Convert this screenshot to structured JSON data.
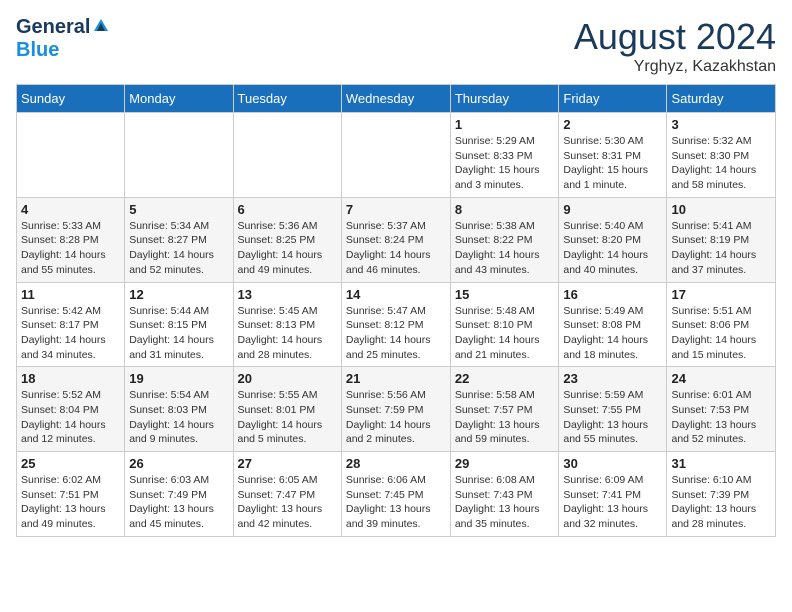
{
  "logo": {
    "general": "General",
    "blue": "Blue"
  },
  "title": "August 2024",
  "location": "Yrghyz, Kazakhstan",
  "days_of_week": [
    "Sunday",
    "Monday",
    "Tuesday",
    "Wednesday",
    "Thursday",
    "Friday",
    "Saturday"
  ],
  "weeks": [
    [
      {
        "day": "",
        "info": ""
      },
      {
        "day": "",
        "info": ""
      },
      {
        "day": "",
        "info": ""
      },
      {
        "day": "",
        "info": ""
      },
      {
        "day": "1",
        "info": "Sunrise: 5:29 AM\nSunset: 8:33 PM\nDaylight: 15 hours and 3 minutes."
      },
      {
        "day": "2",
        "info": "Sunrise: 5:30 AM\nSunset: 8:31 PM\nDaylight: 15 hours and 1 minute."
      },
      {
        "day": "3",
        "info": "Sunrise: 5:32 AM\nSunset: 8:30 PM\nDaylight: 14 hours and 58 minutes."
      }
    ],
    [
      {
        "day": "4",
        "info": "Sunrise: 5:33 AM\nSunset: 8:28 PM\nDaylight: 14 hours and 55 minutes."
      },
      {
        "day": "5",
        "info": "Sunrise: 5:34 AM\nSunset: 8:27 PM\nDaylight: 14 hours and 52 minutes."
      },
      {
        "day": "6",
        "info": "Sunrise: 5:36 AM\nSunset: 8:25 PM\nDaylight: 14 hours and 49 minutes."
      },
      {
        "day": "7",
        "info": "Sunrise: 5:37 AM\nSunset: 8:24 PM\nDaylight: 14 hours and 46 minutes."
      },
      {
        "day": "8",
        "info": "Sunrise: 5:38 AM\nSunset: 8:22 PM\nDaylight: 14 hours and 43 minutes."
      },
      {
        "day": "9",
        "info": "Sunrise: 5:40 AM\nSunset: 8:20 PM\nDaylight: 14 hours and 40 minutes."
      },
      {
        "day": "10",
        "info": "Sunrise: 5:41 AM\nSunset: 8:19 PM\nDaylight: 14 hours and 37 minutes."
      }
    ],
    [
      {
        "day": "11",
        "info": "Sunrise: 5:42 AM\nSunset: 8:17 PM\nDaylight: 14 hours and 34 minutes."
      },
      {
        "day": "12",
        "info": "Sunrise: 5:44 AM\nSunset: 8:15 PM\nDaylight: 14 hours and 31 minutes."
      },
      {
        "day": "13",
        "info": "Sunrise: 5:45 AM\nSunset: 8:13 PM\nDaylight: 14 hours and 28 minutes."
      },
      {
        "day": "14",
        "info": "Sunrise: 5:47 AM\nSunset: 8:12 PM\nDaylight: 14 hours and 25 minutes."
      },
      {
        "day": "15",
        "info": "Sunrise: 5:48 AM\nSunset: 8:10 PM\nDaylight: 14 hours and 21 minutes."
      },
      {
        "day": "16",
        "info": "Sunrise: 5:49 AM\nSunset: 8:08 PM\nDaylight: 14 hours and 18 minutes."
      },
      {
        "day": "17",
        "info": "Sunrise: 5:51 AM\nSunset: 8:06 PM\nDaylight: 14 hours and 15 minutes."
      }
    ],
    [
      {
        "day": "18",
        "info": "Sunrise: 5:52 AM\nSunset: 8:04 PM\nDaylight: 14 hours and 12 minutes."
      },
      {
        "day": "19",
        "info": "Sunrise: 5:54 AM\nSunset: 8:03 PM\nDaylight: 14 hours and 9 minutes."
      },
      {
        "day": "20",
        "info": "Sunrise: 5:55 AM\nSunset: 8:01 PM\nDaylight: 14 hours and 5 minutes."
      },
      {
        "day": "21",
        "info": "Sunrise: 5:56 AM\nSunset: 7:59 PM\nDaylight: 14 hours and 2 minutes."
      },
      {
        "day": "22",
        "info": "Sunrise: 5:58 AM\nSunset: 7:57 PM\nDaylight: 13 hours and 59 minutes."
      },
      {
        "day": "23",
        "info": "Sunrise: 5:59 AM\nSunset: 7:55 PM\nDaylight: 13 hours and 55 minutes."
      },
      {
        "day": "24",
        "info": "Sunrise: 6:01 AM\nSunset: 7:53 PM\nDaylight: 13 hours and 52 minutes."
      }
    ],
    [
      {
        "day": "25",
        "info": "Sunrise: 6:02 AM\nSunset: 7:51 PM\nDaylight: 13 hours and 49 minutes."
      },
      {
        "day": "26",
        "info": "Sunrise: 6:03 AM\nSunset: 7:49 PM\nDaylight: 13 hours and 45 minutes."
      },
      {
        "day": "27",
        "info": "Sunrise: 6:05 AM\nSunset: 7:47 PM\nDaylight: 13 hours and 42 minutes."
      },
      {
        "day": "28",
        "info": "Sunrise: 6:06 AM\nSunset: 7:45 PM\nDaylight: 13 hours and 39 minutes."
      },
      {
        "day": "29",
        "info": "Sunrise: 6:08 AM\nSunset: 7:43 PM\nDaylight: 13 hours and 35 minutes."
      },
      {
        "day": "30",
        "info": "Sunrise: 6:09 AM\nSunset: 7:41 PM\nDaylight: 13 hours and 32 minutes."
      },
      {
        "day": "31",
        "info": "Sunrise: 6:10 AM\nSunset: 7:39 PM\nDaylight: 13 hours and 28 minutes."
      }
    ]
  ]
}
